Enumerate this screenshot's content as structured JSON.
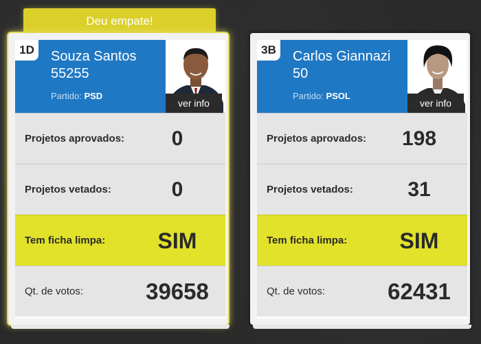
{
  "banner": {
    "text": "Deu empate!"
  },
  "candidates": [
    {
      "code": "1D",
      "name": "Souza Santos",
      "number": "55255",
      "party_label": "Partido:",
      "party": "PSD",
      "info_label": "ver info",
      "projects_approved_label": "Projetos aprovados:",
      "projects_approved": "0",
      "projects_vetoed_label": "Projetos vetados:",
      "projects_vetoed": "0",
      "clean_record_label": "Tem ficha limpa:",
      "clean_record": "SIM",
      "votes_label": "Qt. de votos:",
      "votes": "39658"
    },
    {
      "code": "3B",
      "name": "Carlos Giannazi",
      "number": "50",
      "party_label": "Partido:",
      "party": "PSOL",
      "info_label": "ver info",
      "projects_approved_label": "Projetos aprovados:",
      "projects_approved": "198",
      "projects_vetoed_label": "Projetos vetados:",
      "projects_vetoed": "31",
      "clean_record_label": "Tem ficha limpa:",
      "clean_record": "SIM",
      "votes_label": "Qt. de votos:",
      "votes": "62431"
    }
  ],
  "colors": {
    "header_blue": "#1f78c4",
    "highlight_yellow": "#e2e22a",
    "banner_yellow": "#dbd02a",
    "row_gray": "#e5e5e5"
  }
}
